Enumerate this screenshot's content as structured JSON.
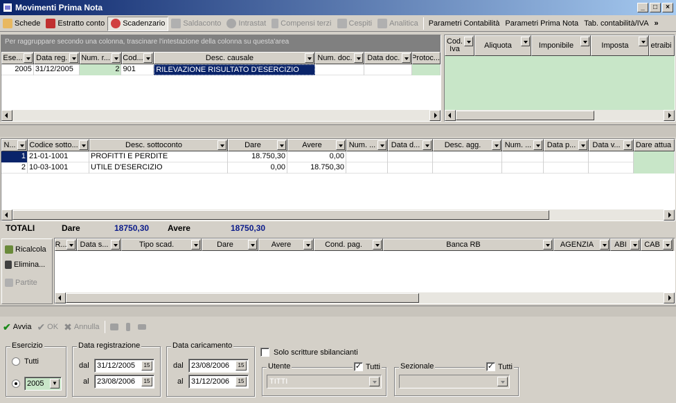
{
  "window": {
    "title": "Movimenti Prima Nota"
  },
  "toolbar": {
    "items": [
      {
        "label": "Schede",
        "icon": "cards-icon"
      },
      {
        "label": "Estratto conto",
        "icon": "statement-icon"
      },
      {
        "label": "Scadenzario",
        "icon": "alarm-clock-icon"
      },
      {
        "label": "Saldaconto",
        "icon": "car-icon"
      },
      {
        "label": "Intrastat",
        "icon": "globe-icon"
      },
      {
        "label": "Compensi terzi",
        "icon": "document-icon"
      },
      {
        "label": "Cespiti",
        "icon": "assets-icon"
      },
      {
        "label": "Analitica",
        "icon": "analytics-icon"
      }
    ],
    "right": [
      "Parametri Contabilità",
      "Parametri Prima Nota",
      "Tab. contabilità/IVA"
    ]
  },
  "top_grid": {
    "group_hint": "Per raggruppare secondo una colonna, trascinare l'intestazione della colonna su questa'area",
    "columns": [
      "Ese...",
      "Data reg.",
      "Num. r...",
      "Cod...",
      "Desc. causale",
      "Num. doc.",
      "Data doc.",
      "Protoc..."
    ],
    "rows": [
      [
        "2005",
        "31/12/2005",
        "2",
        "901",
        "RILEVAZIONE RISULTATO D'ESERCIZIO",
        "",
        "",
        ""
      ]
    ]
  },
  "iva_grid": {
    "columns": [
      "Cod. Iva",
      "Aliquota",
      "Imponibile",
      "Imposta",
      "etraibi"
    ]
  },
  "detail_grid": {
    "columns": [
      "N...",
      "Codice sotto...",
      "Desc. sottoconto",
      "Dare",
      "Avere",
      "Num. ...",
      "Data d...",
      "Desc. agg.",
      "Num. ...",
      "Data p...",
      "Data v...",
      "Dare attua"
    ],
    "rows": [
      [
        "1",
        "21-01-1001",
        "PROFITTI E PERDITE",
        "18.750,30",
        "0,00"
      ],
      [
        "2",
        "10-03-1001",
        "UTILE D'ESERCIZIO",
        "0,00",
        "18.750,30"
      ]
    ]
  },
  "totals": {
    "label": "TOTALI",
    "dare_label": "Dare",
    "dare_value": "18750,30",
    "avere_label": "Avere",
    "avere_value": "18750,30"
  },
  "side_actions": {
    "ricalcola": "Ricalcola",
    "elimina": "Elimina...",
    "partite": "Partite"
  },
  "scad_grid": {
    "columns": [
      "R...",
      "Data s...",
      "Tipo scad.",
      "Dare",
      "Avere",
      "Cond. pag.",
      "Banca RB",
      "AGENZIA",
      "ABI",
      "CAB"
    ]
  },
  "actions": {
    "avvia": "Avvia",
    "ok": "OK",
    "annulla": "Annulla"
  },
  "filters": {
    "esercizio": {
      "legend": "Esercizio",
      "tutti": "Tutti",
      "value": "2005"
    },
    "data_reg": {
      "legend": "Data registrazione",
      "dal_label": "dal",
      "dal": "31/12/2005",
      "al_label": "al",
      "al": "23/08/2006"
    },
    "data_car": {
      "legend": "Data caricamento",
      "dal_label": "dal",
      "dal": "23/08/2006",
      "al_label": "al",
      "al": "31/12/2006"
    },
    "sbilanciate": "Solo scritture sbilancianti",
    "utente": {
      "legend": "Utente",
      "tutti": "Tutti",
      "value": "TITTI"
    },
    "sezionale": {
      "legend": "Sezionale",
      "tutti": "Tutti",
      "value": ""
    }
  }
}
